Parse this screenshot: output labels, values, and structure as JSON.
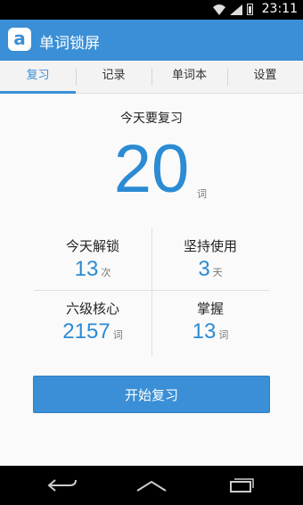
{
  "status_bar": {
    "time": "23:11"
  },
  "app": {
    "logo_letter": "a",
    "title": "单词锁屏",
    "accent": "#3a8fd6"
  },
  "tabs": [
    {
      "label": "复习",
      "selected": true
    },
    {
      "label": "记录",
      "selected": false
    },
    {
      "label": "单词本",
      "selected": false
    },
    {
      "label": "设置",
      "selected": false
    }
  ],
  "review": {
    "label": "今天要复习",
    "count": "20",
    "unit": "词"
  },
  "stats": [
    {
      "label": "今天解锁",
      "value": "13",
      "unit": "次"
    },
    {
      "label": "坚持使用",
      "value": "3",
      "unit": "天"
    },
    {
      "label": "六级核心",
      "value": "2157",
      "unit": "词"
    },
    {
      "label": "掌握",
      "value": "13",
      "unit": "词"
    }
  ],
  "start_button": {
    "label": "开始复习"
  },
  "nav_icons": [
    "back-icon",
    "home-icon",
    "recent-apps-icon"
  ]
}
